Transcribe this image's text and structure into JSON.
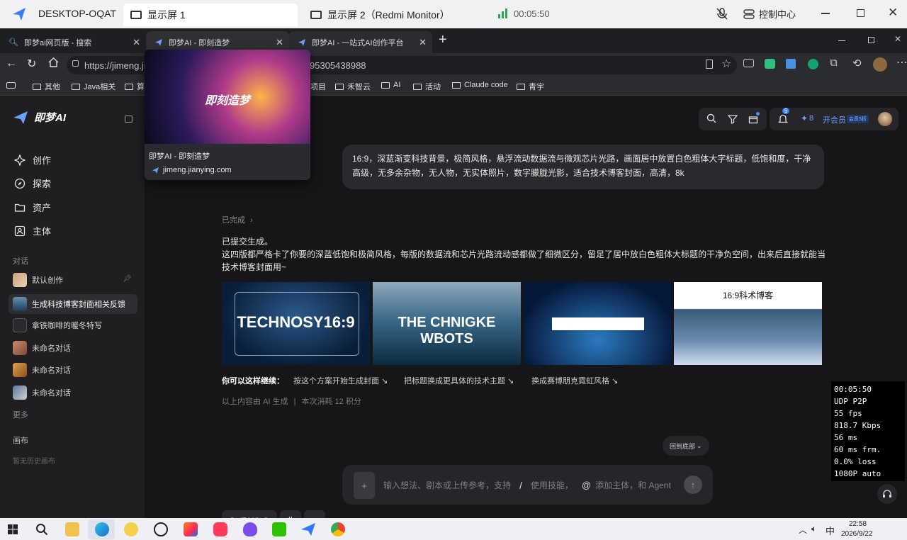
{
  "remote": {
    "machine": "DESKTOP-OQAT",
    "tabs": [
      "显示屏 1",
      "显示屏 2（Redmi Monitor）"
    ],
    "timer": "00:05:50",
    "control_center": "控制中心"
  },
  "browser": {
    "tabs": [
      {
        "label": "即梦ai网页版 - 搜索"
      },
      {
        "label": "即梦AI - 即刻造梦"
      },
      {
        "label": "即梦AI - 一站式AI创作平台"
      }
    ],
    "url_start": "https://jimeng.jia",
    "url_end": "95305438988",
    "bookmarks": [
      "其他",
      "Java相关",
      "算",
      "项目",
      "禾智云",
      "AI",
      "活动",
      "Claude code",
      "青宇"
    ]
  },
  "popup": {
    "image_text": "即刻造梦",
    "title": "即梦AI - 即刻造梦",
    "domain": "jimeng.jianying.com"
  },
  "sidebar": {
    "logo": "即梦AI",
    "nav": [
      "创作",
      "探索",
      "资产",
      "主体"
    ],
    "section_conversations": "对话",
    "conversations": [
      "默认创作",
      "生成科技博客封面相关反馈",
      "拿铁咖啡的暖冬特写",
      "未命名对话",
      "未命名对话",
      "未命名对话"
    ],
    "more": "更多",
    "section_canvas": "画布",
    "no_canvas": "暂无历史画布"
  },
  "header": {
    "notif_count": "9",
    "points": "8",
    "vip": "开会员",
    "vip_badge": "会员5折"
  },
  "chat": {
    "user_prompt": "16:9，深蓝渐变科技背景，极简风格，悬浮流动数据流与微观芯片光路，画面居中放置白色粗体大字标题，低饱和度，干净高级，无多余杂物，无人物，无实体照片，数字朦胧光影，适合技术博客封面，高清，8k",
    "status": "已完成",
    "reply_line1": "已提交生成。",
    "reply_line2": "这四版都严格卡了你要的深蓝低饱和极简风格，每版的数据流和芯片光路流动感都做了细微区分，留足了居中放白色粗体大标题的干净负空间，出来后直接就能当技术博客封面用~",
    "images": [
      "TECHNOSY16:9",
      "THE CHNIGKE WBOTS",
      "",
      "16:9科术博客"
    ],
    "continue_label": "你可以这样继续：",
    "suggestions": [
      "按这个方案开始生成封面",
      "把标题换成更具体的技术主题",
      "换成赛博朋克霓虹风格"
    ],
    "ai_note": "以上内容由 AI 生成",
    "cost": "本次消耗 12 积分",
    "regenerate": "重新生成",
    "back_bottom": "回到底部",
    "input_placeholder": "输入想法、剧本或上传参考，支持",
    "input_skill": "使用技能，",
    "input_agent": "添加主体，和 Agent"
  },
  "stats": [
    "00:05:50",
    "UDP P2P",
    "55 fps",
    "818.7 Kbps",
    "56 ms",
    "60 ms frm.",
    "0.0% loss",
    "1080P auto"
  ],
  "taskbar": {
    "ime": "中",
    "time": "22:58",
    "date": "2026/9/22"
  }
}
